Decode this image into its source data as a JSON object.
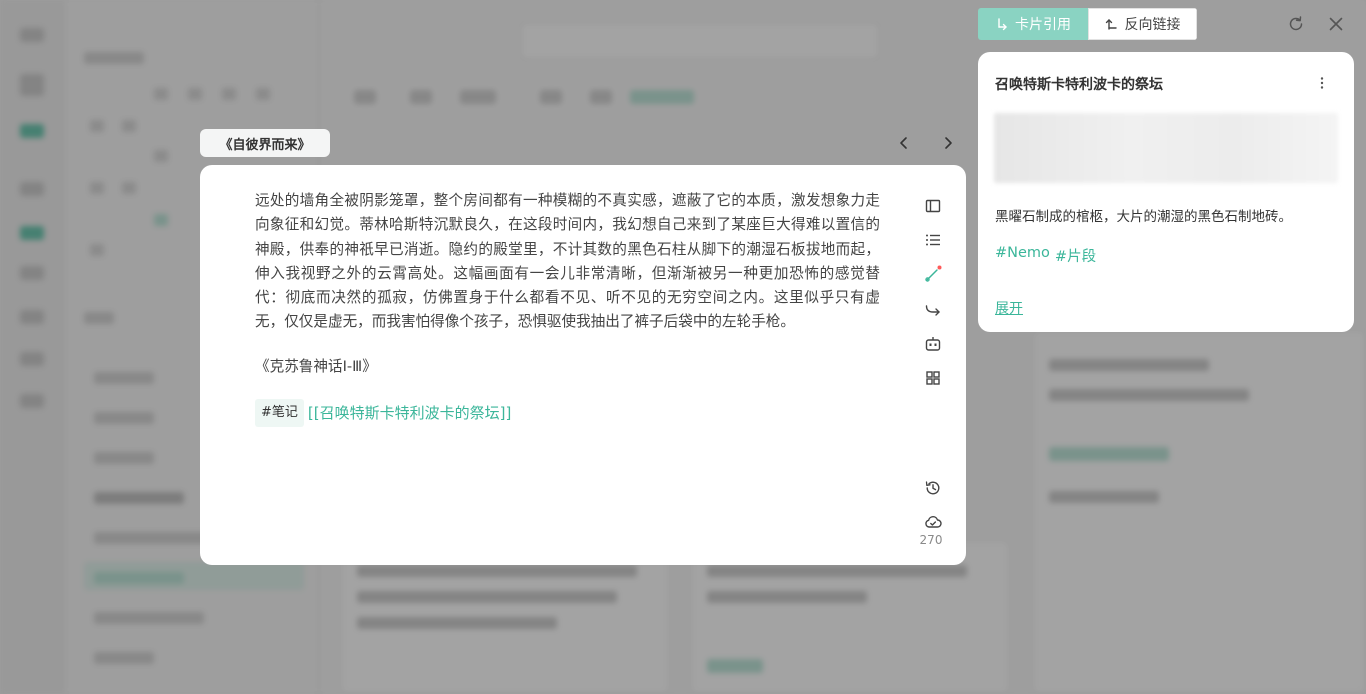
{
  "colors": {
    "accent": "#3bb69a",
    "accent_active_tab": "#8ad3c2",
    "overlay": "rgba(0,0,0,0.36)",
    "notification_dot": "#ff5a5a"
  },
  "editor": {
    "source_tag": "《自彼界而来》",
    "body": "远处的墙角全被阴影笼罩，整个房间都有一种模糊的不真实感，遮蔽了它的本质，激发想象力走向象征和幻觉。蒂林哈斯特沉默良久，在这段时间内，我幻想自己来到了某座巨大得难以置信的神殿，供奉的神祇早已消逝。隐约的殿堂里，不计其数的黑色石柱从脚下的潮湿石板拔地而起，伸入我视野之外的云霄高处。这幅画面有一会儿非常清晰，但渐渐被另一种更加恐怖的感觉替代：彻底而决然的孤寂，仿佛置身于什么都看不见、听不见的无穷空间之内。这里似乎只有虚无，仅仅是虚无，而我害怕得像个孩子，恐惧驱使我抽出了裤子后袋中的左轮手枪。",
    "citation": "《克苏鲁神话Ⅰ-Ⅲ》",
    "tag": "#笔记",
    "link": "[[召唤特斯卡特利波卡的祭坛]]",
    "char_count": "270",
    "tools": [
      "sidebar-icon",
      "list-icon",
      "link-pen-icon",
      "share-icon",
      "ai-robot-icon",
      "grid-icon",
      "history-icon",
      "cloud-sync-icon"
    ],
    "nav_icons": [
      "chevron-left-icon",
      "chevron-right-icon"
    ]
  },
  "panel": {
    "tab_card_reference": "卡片引用",
    "tab_backlinks": "反向链接",
    "top_icons": [
      "refresh-icon",
      "close-icon"
    ],
    "card": {
      "title": "召唤特斯卡特利波卡的祭坛",
      "text": "黑曜石制成的棺柩，大片的潮湿的黑色石制地砖。",
      "tags": [
        "#Nemo",
        "#片段"
      ],
      "expand": "展开"
    }
  }
}
